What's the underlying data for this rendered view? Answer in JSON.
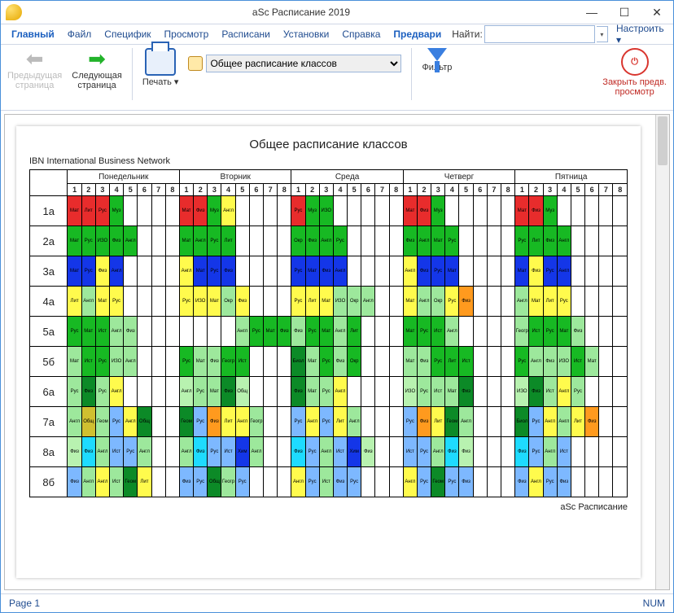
{
  "window": {
    "title": "aSc Расписание 2019"
  },
  "winbtns": {
    "min": "—",
    "max": "☐",
    "close": "✕"
  },
  "menu": {
    "items": [
      "Главный",
      "Файл",
      "Специфик",
      "Просмотр",
      "Расписани",
      "Установки",
      "Справка",
      "Предвари"
    ],
    "search_label": "Найти:",
    "search_value": "",
    "configure": "Настроить ▾"
  },
  "ribbon": {
    "prev": "Предыдущая\nстраница",
    "next": "Следующая\nстраница",
    "print": "Печать ▾",
    "combo_selected": "Общее расписание классов",
    "filter": "Фильтр",
    "close_preview": "Закрыть предв.\nпросмотр"
  },
  "page": {
    "heading": "Общее расписание классов",
    "org": "IBN International Business Network",
    "footer": "aSc Расписание"
  },
  "status": {
    "page": "Page 1",
    "num": "NUM"
  },
  "days": [
    "Понедельник",
    "Вторник",
    "Среда",
    "Четверг",
    "Пятница"
  ],
  "periods": [
    "1",
    "2",
    "3",
    "4",
    "5",
    "6",
    "7",
    "8"
  ],
  "classes": [
    "1а",
    "2а",
    "3а",
    "4а",
    "5а",
    "5б",
    "6а",
    "7а",
    "8а",
    "8б"
  ],
  "palette": {
    "r": "#e82c2c",
    "g": "#17b923",
    "b": "#1436e8",
    "y": "#fffb4d",
    "lg": "#9de89c",
    "dg": "#0c8a27",
    "lb": "#7db8ff",
    "or": "#ff9a1e",
    "pk": "#ffb6b6",
    "cy": "#1edbff",
    "gr": "#c9c9c9",
    "wt": "#ffffff",
    "dy": "#d0c030",
    "pg": "#b8f2b0"
  },
  "cells": [
    [
      [
        "Мат",
        "r"
      ],
      [
        "Лит",
        "r"
      ],
      [
        "Рус",
        "r"
      ],
      [
        "Муз",
        "g"
      ],
      [
        "",
        "wt"
      ],
      [
        "",
        "wt"
      ],
      [
        "",
        "wt"
      ],
      [
        "",
        "wt"
      ],
      [
        "Мат",
        "r"
      ],
      [
        "Физ",
        "r"
      ],
      [
        "Муз",
        "g"
      ],
      [
        "Англ",
        "y"
      ],
      [
        "",
        "wt"
      ],
      [
        "",
        "wt"
      ],
      [
        "",
        "wt"
      ],
      [
        "",
        "wt"
      ],
      [
        "Рус",
        "r"
      ],
      [
        "Муз",
        "g"
      ],
      [
        "ИЗО",
        "g"
      ],
      [
        "",
        "wt"
      ],
      [
        "",
        "wt"
      ],
      [
        "",
        "wt"
      ],
      [
        "",
        "wt"
      ],
      [
        "",
        "wt"
      ],
      [
        "Мат",
        "r"
      ],
      [
        "Физ",
        "r"
      ],
      [
        "Муз",
        "g"
      ],
      [
        "",
        "wt"
      ],
      [
        "",
        "wt"
      ],
      [
        "",
        "wt"
      ],
      [
        "",
        "wt"
      ],
      [
        "",
        "wt"
      ],
      [
        "Мат",
        "r"
      ],
      [
        "Физ",
        "r"
      ],
      [
        "Муз",
        "g"
      ],
      [
        "",
        "wt"
      ],
      [
        "",
        "wt"
      ],
      [
        "",
        "wt"
      ],
      [
        "",
        "wt"
      ],
      [
        "",
        "wt"
      ]
    ],
    [
      [
        "Мат",
        "g"
      ],
      [
        "Рус",
        "g"
      ],
      [
        "ИЗО",
        "g"
      ],
      [
        "Физ",
        "g"
      ],
      [
        "Англ",
        "g"
      ],
      [
        "",
        "wt"
      ],
      [
        "",
        "wt"
      ],
      [
        "",
        "wt"
      ],
      [
        "Мат",
        "g"
      ],
      [
        "Англ",
        "g"
      ],
      [
        "Рус",
        "g"
      ],
      [
        "Лит",
        "g"
      ],
      [
        "",
        "wt"
      ],
      [
        "",
        "wt"
      ],
      [
        "",
        "wt"
      ],
      [
        "",
        "wt"
      ],
      [
        "Окр",
        "g"
      ],
      [
        "Физ",
        "g"
      ],
      [
        "Англ",
        "g"
      ],
      [
        "Рус",
        "g"
      ],
      [
        "",
        "wt"
      ],
      [
        "",
        "wt"
      ],
      [
        "",
        "wt"
      ],
      [
        "",
        "wt"
      ],
      [
        "Физ",
        "g"
      ],
      [
        "Англ",
        "g"
      ],
      [
        "Мат",
        "g"
      ],
      [
        "Рус",
        "g"
      ],
      [
        "",
        "wt"
      ],
      [
        "",
        "wt"
      ],
      [
        "",
        "wt"
      ],
      [
        "",
        "wt"
      ],
      [
        "Рус",
        "g"
      ],
      [
        "Лит",
        "g"
      ],
      [
        "Физ",
        "g"
      ],
      [
        "Англ",
        "g"
      ],
      [
        "",
        "wt"
      ],
      [
        "",
        "wt"
      ],
      [
        "",
        "wt"
      ],
      [
        "",
        "wt"
      ]
    ],
    [
      [
        "Мат",
        "b"
      ],
      [
        "Рус",
        "b"
      ],
      [
        "Физ",
        "y"
      ],
      [
        "Англ",
        "b"
      ],
      [
        "",
        "wt"
      ],
      [
        "",
        "wt"
      ],
      [
        "",
        "wt"
      ],
      [
        "",
        "wt"
      ],
      [
        "Англ",
        "y"
      ],
      [
        "Мат",
        "b"
      ],
      [
        "Рус",
        "b"
      ],
      [
        "Физ",
        "b"
      ],
      [
        "",
        "wt"
      ],
      [
        "",
        "wt"
      ],
      [
        "",
        "wt"
      ],
      [
        "",
        "wt"
      ],
      [
        "Рус",
        "b"
      ],
      [
        "Мат",
        "b"
      ],
      [
        "Физ",
        "b"
      ],
      [
        "Англ",
        "b"
      ],
      [
        "",
        "wt"
      ],
      [
        "",
        "wt"
      ],
      [
        "",
        "wt"
      ],
      [
        "",
        "wt"
      ],
      [
        "Англ",
        "y"
      ],
      [
        "Физ",
        "b"
      ],
      [
        "Рус",
        "b"
      ],
      [
        "Мат",
        "b"
      ],
      [
        "",
        "wt"
      ],
      [
        "",
        "wt"
      ],
      [
        "",
        "wt"
      ],
      [
        "",
        "wt"
      ],
      [
        "Мат",
        "b"
      ],
      [
        "Физ",
        "y"
      ],
      [
        "Рус",
        "b"
      ],
      [
        "Англ",
        "b"
      ],
      [
        "",
        "wt"
      ],
      [
        "",
        "wt"
      ],
      [
        "",
        "wt"
      ],
      [
        "",
        "wt"
      ]
    ],
    [
      [
        "Лит",
        "y"
      ],
      [
        "Англ",
        "lg"
      ],
      [
        "Мат",
        "y"
      ],
      [
        "Рус",
        "y"
      ],
      [
        "",
        "wt"
      ],
      [
        "",
        "wt"
      ],
      [
        "",
        "wt"
      ],
      [
        "",
        "wt"
      ],
      [
        "Рус",
        "y"
      ],
      [
        "ИЗО",
        "y"
      ],
      [
        "Мат",
        "y"
      ],
      [
        "Окр",
        "lg"
      ],
      [
        "Физ",
        "y"
      ],
      [
        "",
        "wt"
      ],
      [
        "",
        "wt"
      ],
      [
        "",
        "wt"
      ],
      [
        "Рус",
        "y"
      ],
      [
        "Лит",
        "y"
      ],
      [
        "Мат",
        "y"
      ],
      [
        "ИЗО",
        "lg"
      ],
      [
        "Окр",
        "lg"
      ],
      [
        "Англ",
        "lg"
      ],
      [
        "",
        "wt"
      ],
      [
        "",
        "wt"
      ],
      [
        "Мат",
        "y"
      ],
      [
        "Англ",
        "lg"
      ],
      [
        "Окр",
        "lg"
      ],
      [
        "Рус",
        "y"
      ],
      [
        "Физ",
        "or"
      ],
      [
        "",
        "wt"
      ],
      [
        "",
        "wt"
      ],
      [
        "",
        "wt"
      ],
      [
        "Англ",
        "lg"
      ],
      [
        "Мат",
        "y"
      ],
      [
        "Лит",
        "y"
      ],
      [
        "Рус",
        "y"
      ],
      [
        "",
        "wt"
      ],
      [
        "",
        "wt"
      ],
      [
        "",
        "wt"
      ],
      [
        "",
        "wt"
      ]
    ],
    [
      [
        "Рус",
        "g"
      ],
      [
        "Мат",
        "g"
      ],
      [
        "Ист",
        "g"
      ],
      [
        "Англ",
        "lg"
      ],
      [
        "Физ",
        "lg"
      ],
      [
        "",
        "wt"
      ],
      [
        "",
        "wt"
      ],
      [
        "",
        "wt"
      ],
      [
        "",
        "wt"
      ],
      [
        "",
        "wt"
      ],
      [
        "",
        "wt"
      ],
      [
        "",
        "wt"
      ],
      [
        "Англ",
        "lg"
      ],
      [
        "Рус",
        "g"
      ],
      [
        "Мат",
        "g"
      ],
      [
        "Физ",
        "g"
      ],
      [
        "Физ",
        "lg"
      ],
      [
        "Рус",
        "g"
      ],
      [
        "Мат",
        "g"
      ],
      [
        "Англ",
        "lg"
      ],
      [
        "Лит",
        "g"
      ],
      [
        "",
        "wt"
      ],
      [
        "",
        "wt"
      ],
      [
        "",
        "wt"
      ],
      [
        "Мат",
        "g"
      ],
      [
        "Рус",
        "g"
      ],
      [
        "Ист",
        "g"
      ],
      [
        "Англ",
        "lg"
      ],
      [
        "",
        "wt"
      ],
      [
        "",
        "wt"
      ],
      [
        "",
        "wt"
      ],
      [
        "",
        "wt"
      ],
      [
        "Геогр",
        "lg"
      ],
      [
        "Ист",
        "g"
      ],
      [
        "Рус",
        "g"
      ],
      [
        "Мат",
        "g"
      ],
      [
        "Физ",
        "lg"
      ],
      [
        "",
        "wt"
      ],
      [
        "",
        "wt"
      ],
      [
        "",
        "wt"
      ]
    ],
    [
      [
        "Мат",
        "lg"
      ],
      [
        "Ист",
        "g"
      ],
      [
        "Рус",
        "g"
      ],
      [
        "ИЗО",
        "lg"
      ],
      [
        "Англ",
        "lg"
      ],
      [
        "",
        "wt"
      ],
      [
        "",
        "wt"
      ],
      [
        "",
        "wt"
      ],
      [
        "Рус",
        "g"
      ],
      [
        "Мат",
        "lg"
      ],
      [
        "Физ",
        "lg"
      ],
      [
        "Геогр",
        "g"
      ],
      [
        "Ист",
        "g"
      ],
      [
        "",
        "wt"
      ],
      [
        "",
        "wt"
      ],
      [
        "",
        "wt"
      ],
      [
        "Биол",
        "dg"
      ],
      [
        "Мат",
        "lg"
      ],
      [
        "Рус",
        "g"
      ],
      [
        "Физ",
        "lg"
      ],
      [
        "Окр",
        "g"
      ],
      [
        "",
        "wt"
      ],
      [
        "",
        "wt"
      ],
      [
        "",
        "wt"
      ],
      [
        "Мат",
        "lg"
      ],
      [
        "Физ",
        "lg"
      ],
      [
        "Рус",
        "g"
      ],
      [
        "Лит",
        "g"
      ],
      [
        "Ист",
        "g"
      ],
      [
        "",
        "wt"
      ],
      [
        "",
        "wt"
      ],
      [
        "",
        "wt"
      ],
      [
        "Рус",
        "g"
      ],
      [
        "Англ",
        "lg"
      ],
      [
        "Физ",
        "lg"
      ],
      [
        "ИЗО",
        "lg"
      ],
      [
        "Ист",
        "g"
      ],
      [
        "Мат",
        "lg"
      ],
      [
        "",
        "wt"
      ],
      [
        "",
        "wt"
      ]
    ],
    [
      [
        "Рус",
        "lg"
      ],
      [
        "Физ",
        "dg"
      ],
      [
        "Рус",
        "lg"
      ],
      [
        "Англ",
        "y"
      ],
      [
        "",
        "wt"
      ],
      [
        "",
        "wt"
      ],
      [
        "",
        "wt"
      ],
      [
        "",
        "wt"
      ],
      [
        "Англ",
        "pg"
      ],
      [
        "Рус",
        "lg"
      ],
      [
        "Мат",
        "lg"
      ],
      [
        "Физ",
        "dg"
      ],
      [
        "Общ",
        "pg"
      ],
      [
        "",
        "wt"
      ],
      [
        "",
        "wt"
      ],
      [
        "",
        "wt"
      ],
      [
        "Физ",
        "dg"
      ],
      [
        "Мат",
        "lg"
      ],
      [
        "Рус",
        "lg"
      ],
      [
        "Англ",
        "y"
      ],
      [
        "",
        "wt"
      ],
      [
        "",
        "wt"
      ],
      [
        "",
        "wt"
      ],
      [
        "",
        "wt"
      ],
      [
        "ИЗО",
        "pg"
      ],
      [
        "Рус",
        "lg"
      ],
      [
        "Ист",
        "lg"
      ],
      [
        "Мат",
        "lg"
      ],
      [
        "Физ",
        "dg"
      ],
      [
        "",
        "wt"
      ],
      [
        "",
        "wt"
      ],
      [
        "",
        "wt"
      ],
      [
        "ИЗО",
        "pg"
      ],
      [
        "Физ",
        "dg"
      ],
      [
        "Ист",
        "lg"
      ],
      [
        "Англ",
        "y"
      ],
      [
        "Рус",
        "lg"
      ],
      [
        "",
        "wt"
      ],
      [
        "",
        "wt"
      ],
      [
        "",
        "wt"
      ]
    ],
    [
      [
        "Англ",
        "lg"
      ],
      [
        "Общ",
        "dy"
      ],
      [
        "Геом",
        "lg"
      ],
      [
        "Рус",
        "lb"
      ],
      [
        "Англ",
        "y"
      ],
      [
        "Общ",
        "dg"
      ],
      [
        "",
        "wt"
      ],
      [
        "",
        "wt"
      ],
      [
        "Геом",
        "dg"
      ],
      [
        "Рус",
        "lb"
      ],
      [
        "Физ",
        "or"
      ],
      [
        "Лит",
        "y"
      ],
      [
        "Англ",
        "y"
      ],
      [
        "Геогр",
        "lg"
      ],
      [
        "",
        "wt"
      ],
      [
        "",
        "wt"
      ],
      [
        "Рус",
        "lb"
      ],
      [
        "Англ",
        "y"
      ],
      [
        "Рус",
        "lb"
      ],
      [
        "Лит",
        "y"
      ],
      [
        "Англ",
        "lg"
      ],
      [
        "",
        "wt"
      ],
      [
        "",
        "wt"
      ],
      [
        "",
        "wt"
      ],
      [
        "Рус",
        "lb"
      ],
      [
        "Физ",
        "or"
      ],
      [
        "Лит",
        "y"
      ],
      [
        "Геом",
        "dg"
      ],
      [
        "Англ",
        "lg"
      ],
      [
        "",
        "wt"
      ],
      [
        "",
        "wt"
      ],
      [
        "",
        "wt"
      ],
      [
        "Биол",
        "dg"
      ],
      [
        "Рус",
        "lb"
      ],
      [
        "Англ",
        "y"
      ],
      [
        "Англ",
        "lg"
      ],
      [
        "Лит",
        "y"
      ],
      [
        "Физ",
        "or"
      ],
      [
        "",
        "wt"
      ],
      [
        "",
        "wt"
      ]
    ],
    [
      [
        "Физ",
        "pg"
      ],
      [
        "Физ",
        "cy"
      ],
      [
        "Англ",
        "lg"
      ],
      [
        "Ист",
        "lb"
      ],
      [
        "Рус",
        "lb"
      ],
      [
        "Англ",
        "lg"
      ],
      [
        "",
        "wt"
      ],
      [
        "",
        "wt"
      ],
      [
        "Англ",
        "lg"
      ],
      [
        "Физ",
        "cy"
      ],
      [
        "Рус",
        "lb"
      ],
      [
        "Ист",
        "lb"
      ],
      [
        "Хим",
        "b"
      ],
      [
        "Англ",
        "lg"
      ],
      [
        "",
        "wt"
      ],
      [
        "",
        "wt"
      ],
      [
        "Физ",
        "cy"
      ],
      [
        "Рус",
        "lb"
      ],
      [
        "Англ",
        "lg"
      ],
      [
        "Ист",
        "lb"
      ],
      [
        "Хим",
        "b"
      ],
      [
        "Физ",
        "pg"
      ],
      [
        "",
        "wt"
      ],
      [
        "",
        "wt"
      ],
      [
        "Ист",
        "lb"
      ],
      [
        "Рус",
        "lb"
      ],
      [
        "Англ",
        "lg"
      ],
      [
        "Физ",
        "cy"
      ],
      [
        "Физ",
        "pg"
      ],
      [
        "",
        "wt"
      ],
      [
        "",
        "wt"
      ],
      [
        "",
        "wt"
      ],
      [
        "Физ",
        "cy"
      ],
      [
        "Рус",
        "lb"
      ],
      [
        "Англ",
        "lg"
      ],
      [
        "Ист",
        "lb"
      ],
      [
        "",
        "wt"
      ],
      [
        "",
        "wt"
      ],
      [
        "",
        "wt"
      ],
      [
        "",
        "wt"
      ]
    ],
    [
      [
        "Физ",
        "lb"
      ],
      [
        "Англ",
        "lg"
      ],
      [
        "Англ",
        "y"
      ],
      [
        "Ист",
        "lg"
      ],
      [
        "Геом",
        "dg"
      ],
      [
        "Лит",
        "y"
      ],
      [
        "",
        "wt"
      ],
      [
        "",
        "wt"
      ],
      [
        "Физ",
        "lb"
      ],
      [
        "Рус",
        "lb"
      ],
      [
        "Общ",
        "dg"
      ],
      [
        "Геогр",
        "lg"
      ],
      [
        "Рус",
        "lb"
      ],
      [
        "",
        "wt"
      ],
      [
        "",
        "wt"
      ],
      [
        "",
        "wt"
      ],
      [
        "Англ",
        "y"
      ],
      [
        "Рус",
        "lb"
      ],
      [
        "Ист",
        "lg"
      ],
      [
        "Физ",
        "lb"
      ],
      [
        "Рус",
        "lb"
      ],
      [
        "",
        "wt"
      ],
      [
        "",
        "wt"
      ],
      [
        "",
        "wt"
      ],
      [
        "Англ",
        "y"
      ],
      [
        "Рус",
        "lb"
      ],
      [
        "Геом",
        "dg"
      ],
      [
        "Рус",
        "lb"
      ],
      [
        "Физ",
        "lb"
      ],
      [
        "",
        "wt"
      ],
      [
        "",
        "wt"
      ],
      [
        "",
        "wt"
      ],
      [
        "Физ",
        "lb"
      ],
      [
        "Англ",
        "y"
      ],
      [
        "Рус",
        "lb"
      ],
      [
        "Физ",
        "lb"
      ],
      [
        "",
        "wt"
      ],
      [
        "",
        "wt"
      ],
      [
        "",
        "wt"
      ],
      [
        "",
        "wt"
      ]
    ]
  ]
}
